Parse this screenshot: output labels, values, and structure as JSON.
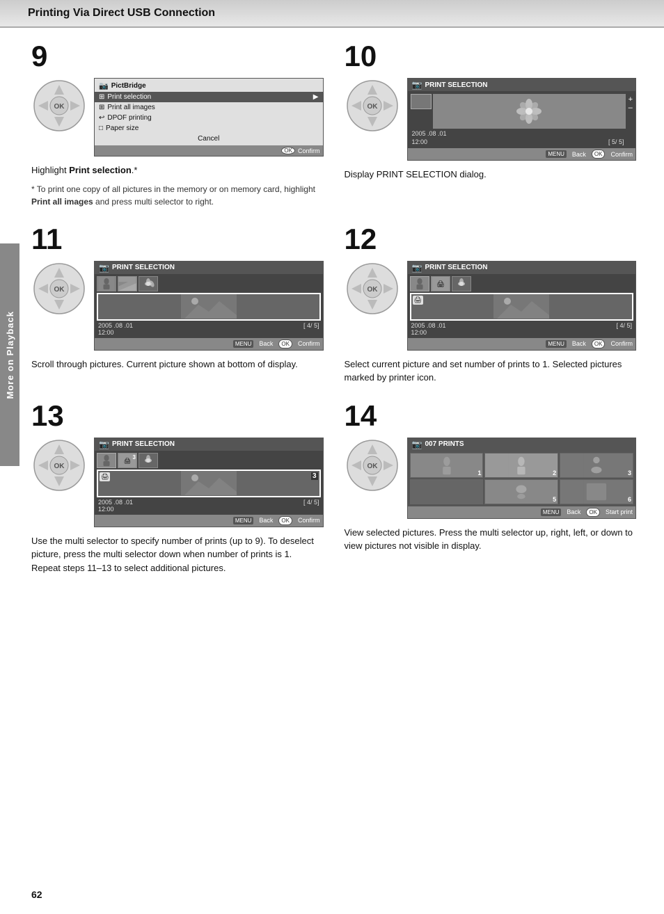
{
  "page": {
    "header": "Printing Via Direct USB Connection",
    "page_number": "62",
    "side_tab": "More on Playback"
  },
  "steps": [
    {
      "id": "9",
      "screen_title": "PictBridge",
      "menu_items": [
        {
          "label": "Print selection",
          "icon": "grid",
          "selected": true,
          "has_arrow": true
        },
        {
          "label": "Print all images",
          "icon": "grid"
        },
        {
          "label": "DPOF printing",
          "icon": "folder"
        },
        {
          "label": "Paper size",
          "icon": "page"
        },
        {
          "label": "Cancel",
          "selected": false
        }
      ],
      "footer": "Confirm",
      "footer_btn": "OK",
      "text": "Highlight Print selection.*",
      "note": "* To print one copy of all pictures in the memory or on memory card, highlight Print all images and press multi selector to right."
    },
    {
      "id": "10",
      "screen_title": "PRINT SELECTION",
      "date": "2005 .08 .01",
      "time": "12:00",
      "counter": "5/ 5",
      "footer_back": "Back",
      "footer_confirm": "Confirm",
      "text": "Display PRINT SELECTION dialog."
    },
    {
      "id": "11",
      "screen_title": "PRINT SELECTION",
      "date": "2005 .08 .01",
      "time": "12:00",
      "counter": "4/ 5",
      "footer_back": "Back",
      "footer_confirm": "Confirm",
      "text": "Scroll through pictures. Current picture shown at bottom of display."
    },
    {
      "id": "12",
      "screen_title": "PRINT SELECTION",
      "date": "2005 .08 .01",
      "time": "12:00",
      "counter": "4/ 5",
      "footer_back": "Back",
      "footer_confirm": "Confirm",
      "text": "Select current picture and set number of prints to 1. Selected pictures marked by printer icon."
    },
    {
      "id": "13",
      "screen_title": "PRINT SELECTION",
      "date": "2005 .08 .01",
      "time": "12:00",
      "counter": "4/ 5",
      "footer_back": "Back",
      "footer_confirm": "Confirm",
      "text": "Use the multi selector to specify number of prints (up to 9). To deselect picture, press the multi selector down when number of prints is 1. Repeat steps 11–13 to select additional pictures."
    },
    {
      "id": "14",
      "screen_title": "007 PRINTS",
      "footer_back": "Back",
      "footer_confirm": "Start print",
      "text": "View selected pictures. Press the multi selector up, right, left, or down to view pictures not visible in display.",
      "print_cells": [
        "1",
        "2",
        "3",
        "",
        "5",
        "6"
      ]
    }
  ]
}
